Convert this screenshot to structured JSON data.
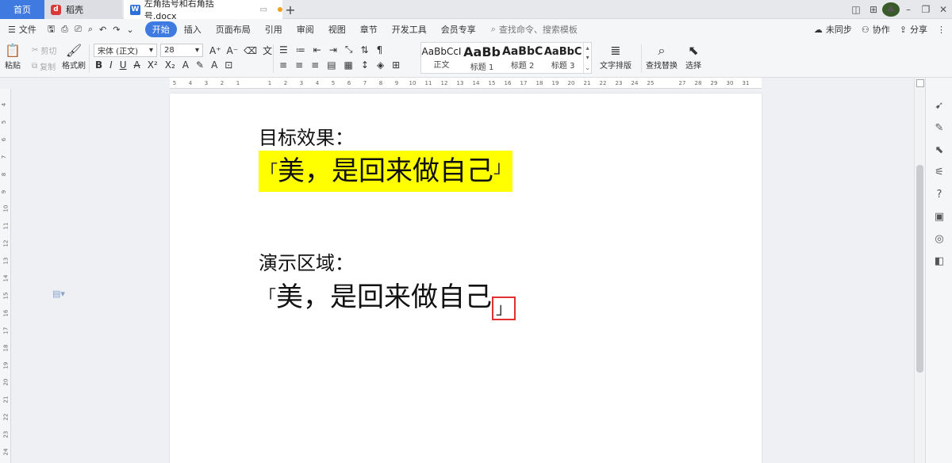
{
  "tabs": {
    "home": "首页",
    "docer": "稻壳",
    "document": "左角括号和右角括号.docx",
    "add": "+"
  },
  "menubar": {
    "file": "文件",
    "tabs": [
      "开始",
      "插入",
      "页面布局",
      "引用",
      "审阅",
      "视图",
      "章节",
      "开发工具",
      "会员专享"
    ],
    "active_tab": "开始",
    "search_placeholder": "查找命令、搜索模板",
    "sync": "未同步",
    "collab": "协作",
    "share": "分享"
  },
  "ribbon": {
    "paste": "粘贴",
    "cut": "剪切",
    "copy": "复制",
    "format_painter": "格式刷",
    "font_name": "宋体 (正文)",
    "font_size": "28",
    "styles": [
      {
        "sample": "AaBbCcI",
        "name": "正文"
      },
      {
        "sample": "AaBb",
        "name": "标题 1"
      },
      {
        "sample": "AaBbC",
        "name": "标题 2"
      },
      {
        "sample": "AaBbC",
        "name": "标题 3"
      }
    ],
    "text_layout": "文字排版",
    "find_replace": "查找替换",
    "select": "选择"
  },
  "ruler": {
    "h_ticks": [
      "5",
      "4",
      "3",
      "2",
      "1",
      "",
      "1",
      "2",
      "3",
      "4",
      "5",
      "6",
      "7",
      "8",
      "9",
      "10",
      "11",
      "12",
      "13",
      "14",
      "15",
      "16",
      "17",
      "18",
      "19",
      "20",
      "21",
      "22",
      "23",
      "24",
      "25",
      "",
      "27",
      "28",
      "29",
      "30",
      "31"
    ],
    "v_ticks": [
      "4",
      "5",
      "6",
      "7",
      "8",
      "9",
      "10",
      "11",
      "12",
      "13",
      "14",
      "15",
      "16",
      "17",
      "18",
      "19",
      "20",
      "21",
      "22",
      "23",
      "24"
    ]
  },
  "document": {
    "heading_target": "目标效果：",
    "target_open": "「",
    "target_text": "美，是回来做自己",
    "target_close": "」",
    "heading_demo": "演示区域：",
    "demo_open": "「",
    "demo_text": "美，是回来做自己",
    "demo_close": "」"
  },
  "colors": {
    "accent": "#3f7ae0",
    "highlight": "#ffff00",
    "annotation_box": "#e03030"
  }
}
